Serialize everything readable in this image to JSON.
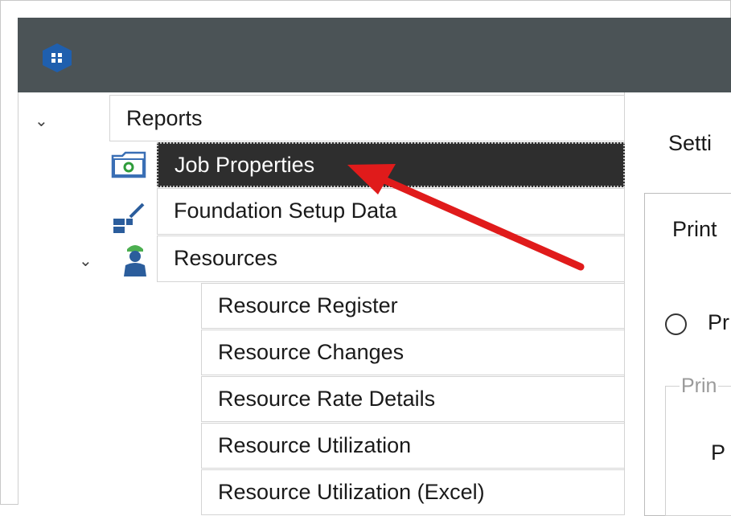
{
  "tree": {
    "root": {
      "label": "Reports"
    },
    "items": [
      {
        "label": "Job Properties",
        "selected": true,
        "icon": "folder-settings-icon"
      },
      {
        "label": "Foundation Setup Data",
        "icon": "setup-data-icon"
      },
      {
        "label": "Resources",
        "icon": "worker-icon",
        "expanded": true,
        "children": [
          {
            "label": "Resource Register"
          },
          {
            "label": "Resource Changes"
          },
          {
            "label": "Resource Rate Details"
          },
          {
            "label": "Resource Utilization"
          },
          {
            "label": "Resource Utilization (Excel)"
          }
        ]
      }
    ]
  },
  "right_panel": {
    "settings_label": "Setti",
    "print_label": "Print",
    "radio_label": "Pr",
    "group_legend": "Prin",
    "group_text": "P"
  },
  "colors": {
    "titlebar": "#4b5356",
    "logo": "#1f5fae",
    "selected_row": "#2e2e2e",
    "annotation_arrow": "#e01b1b"
  }
}
